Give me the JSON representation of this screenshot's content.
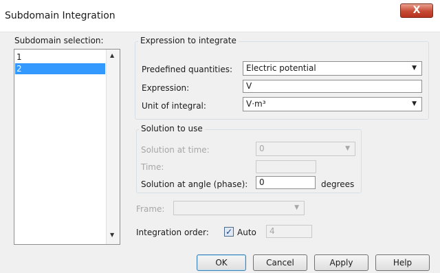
{
  "window": {
    "title": "Subdomain Integration",
    "close_glyph": "X"
  },
  "subdomain": {
    "label": "Subdomain selection:",
    "items": [
      "1",
      "2"
    ],
    "selected": "2"
  },
  "expression_group": {
    "title": "Expression to integrate",
    "predefined_label": "Predefined quantities:",
    "predefined_value": "Electric potential",
    "expression_label": "Expression:",
    "expression_value": "V",
    "unit_label": "Unit of integral:",
    "unit_value": "V·m³"
  },
  "solution_group": {
    "title": "Solution to use",
    "time_label": "Solution at time:",
    "time_value": "0",
    "time_field_label": "Time:",
    "time_field_value": "",
    "angle_label": "Solution at angle (phase):",
    "angle_value": "0",
    "angle_unit": "degrees"
  },
  "frame": {
    "label": "Frame:",
    "value": ""
  },
  "integration": {
    "label": "Integration order:",
    "auto_checked": true,
    "auto_label": "Auto",
    "order_value": "4"
  },
  "buttons": {
    "ok": "OK",
    "cancel": "Cancel",
    "apply": "Apply",
    "help": "Help"
  },
  "icons": {
    "check": "✓",
    "dropdown": "▼",
    "scroll_up": "▲",
    "scroll_down": "▼"
  }
}
